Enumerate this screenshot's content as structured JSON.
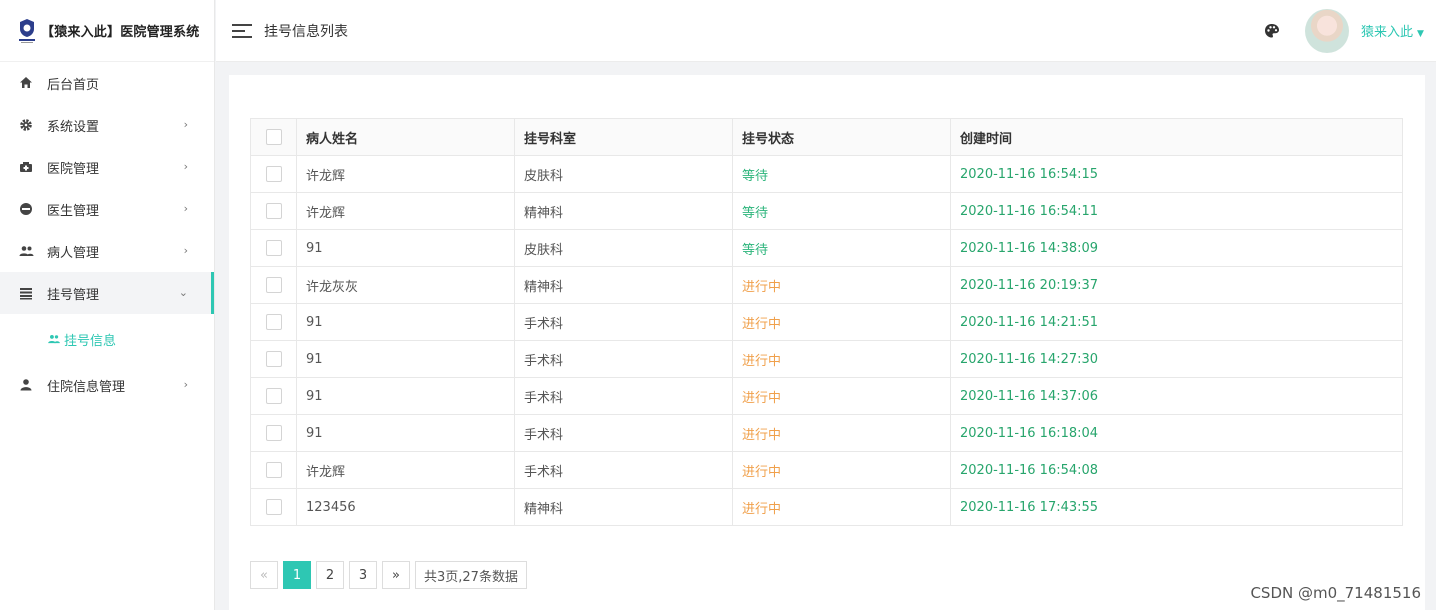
{
  "brand": {
    "title": "【猿来入此】医院管理系统",
    "logo_text": "猿来入此"
  },
  "sidebar": {
    "items": [
      {
        "label": "后台首页",
        "icon": "home-icon",
        "has_children": false
      },
      {
        "label": "系统设置",
        "icon": "gear-icon",
        "has_children": true
      },
      {
        "label": "医院管理",
        "icon": "hospital-icon",
        "has_children": true
      },
      {
        "label": "医生管理",
        "icon": "doctor-icon",
        "has_children": true
      },
      {
        "label": "病人管理",
        "icon": "users-icon",
        "has_children": true
      },
      {
        "label": "挂号管理",
        "icon": "list-icon",
        "has_children": true,
        "expanded": true
      },
      {
        "label": "住院信息管理",
        "icon": "user-icon",
        "has_children": true
      }
    ],
    "submenu": {
      "label": "挂号信息",
      "icon": "users-small-icon"
    }
  },
  "header": {
    "title": "挂号信息列表",
    "username": "猿来入此"
  },
  "table": {
    "columns": [
      "病人姓名",
      "挂号科室",
      "挂号状态",
      "创建时间"
    ],
    "rows": [
      {
        "name": "许龙辉",
        "dept": "皮肤科",
        "status": "等待",
        "time": "2020-11-16 16:54:15"
      },
      {
        "name": "许龙辉",
        "dept": "精神科",
        "status": "等待",
        "time": "2020-11-16 16:54:11"
      },
      {
        "name": "91",
        "dept": "皮肤科",
        "status": "等待",
        "time": "2020-11-16 14:38:09"
      },
      {
        "name": "许龙灰灰",
        "dept": "精神科",
        "status": "进行中",
        "time": "2020-11-16 20:19:37"
      },
      {
        "name": "91",
        "dept": "手术科",
        "status": "进行中",
        "time": "2020-11-16 14:21:51"
      },
      {
        "name": "91",
        "dept": "手术科",
        "status": "进行中",
        "time": "2020-11-16 14:27:30"
      },
      {
        "name": "91",
        "dept": "手术科",
        "status": "进行中",
        "time": "2020-11-16 14:37:06"
      },
      {
        "name": "91",
        "dept": "手术科",
        "status": "进行中",
        "time": "2020-11-16 16:18:04"
      },
      {
        "name": "许龙辉",
        "dept": "手术科",
        "status": "进行中",
        "time": "2020-11-16 16:54:08"
      },
      {
        "name": "123456",
        "dept": "精神科",
        "status": "进行中",
        "time": "2020-11-16 17:43:55"
      }
    ]
  },
  "pagination": {
    "prev": "«",
    "pages": [
      "1",
      "2",
      "3"
    ],
    "current": "1",
    "next": "»",
    "info": "共3页,27条数据"
  },
  "watermark": "CSDN @m0_71481516",
  "colors": {
    "accent": "#2ec7b3",
    "waiting": "#2db57c",
    "in_progress": "#f0a04b",
    "time": "#27a56c"
  }
}
